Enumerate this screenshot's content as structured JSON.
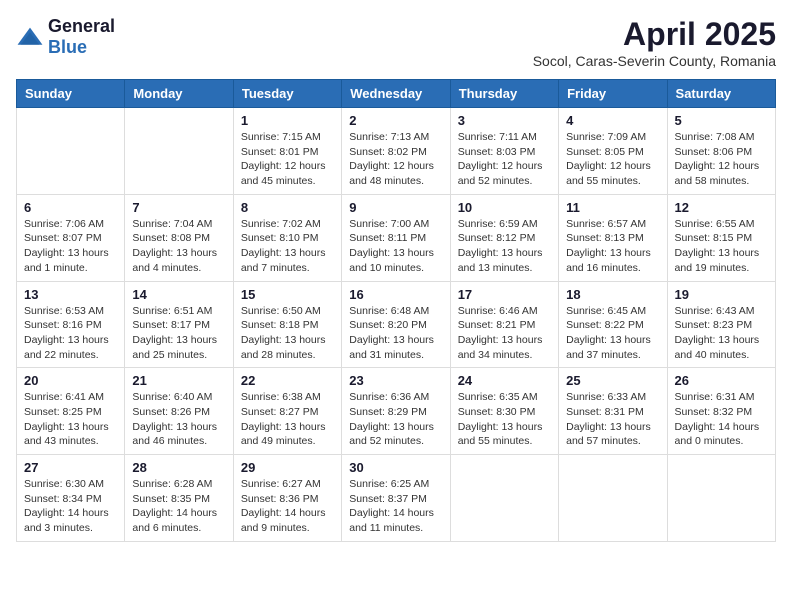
{
  "logo": {
    "general": "General",
    "blue": "Blue"
  },
  "title": "April 2025",
  "subtitle": "Socol, Caras-Severin County, Romania",
  "days_of_week": [
    "Sunday",
    "Monday",
    "Tuesday",
    "Wednesday",
    "Thursday",
    "Friday",
    "Saturday"
  ],
  "weeks": [
    [
      {
        "day": "",
        "info": ""
      },
      {
        "day": "",
        "info": ""
      },
      {
        "day": "1",
        "info": "Sunrise: 7:15 AM\nSunset: 8:01 PM\nDaylight: 12 hours and 45 minutes."
      },
      {
        "day": "2",
        "info": "Sunrise: 7:13 AM\nSunset: 8:02 PM\nDaylight: 12 hours and 48 minutes."
      },
      {
        "day": "3",
        "info": "Sunrise: 7:11 AM\nSunset: 8:03 PM\nDaylight: 12 hours and 52 minutes."
      },
      {
        "day": "4",
        "info": "Sunrise: 7:09 AM\nSunset: 8:05 PM\nDaylight: 12 hours and 55 minutes."
      },
      {
        "day": "5",
        "info": "Sunrise: 7:08 AM\nSunset: 8:06 PM\nDaylight: 12 hours and 58 minutes."
      }
    ],
    [
      {
        "day": "6",
        "info": "Sunrise: 7:06 AM\nSunset: 8:07 PM\nDaylight: 13 hours and 1 minute."
      },
      {
        "day": "7",
        "info": "Sunrise: 7:04 AM\nSunset: 8:08 PM\nDaylight: 13 hours and 4 minutes."
      },
      {
        "day": "8",
        "info": "Sunrise: 7:02 AM\nSunset: 8:10 PM\nDaylight: 13 hours and 7 minutes."
      },
      {
        "day": "9",
        "info": "Sunrise: 7:00 AM\nSunset: 8:11 PM\nDaylight: 13 hours and 10 minutes."
      },
      {
        "day": "10",
        "info": "Sunrise: 6:59 AM\nSunset: 8:12 PM\nDaylight: 13 hours and 13 minutes."
      },
      {
        "day": "11",
        "info": "Sunrise: 6:57 AM\nSunset: 8:13 PM\nDaylight: 13 hours and 16 minutes."
      },
      {
        "day": "12",
        "info": "Sunrise: 6:55 AM\nSunset: 8:15 PM\nDaylight: 13 hours and 19 minutes."
      }
    ],
    [
      {
        "day": "13",
        "info": "Sunrise: 6:53 AM\nSunset: 8:16 PM\nDaylight: 13 hours and 22 minutes."
      },
      {
        "day": "14",
        "info": "Sunrise: 6:51 AM\nSunset: 8:17 PM\nDaylight: 13 hours and 25 minutes."
      },
      {
        "day": "15",
        "info": "Sunrise: 6:50 AM\nSunset: 8:18 PM\nDaylight: 13 hours and 28 minutes."
      },
      {
        "day": "16",
        "info": "Sunrise: 6:48 AM\nSunset: 8:20 PM\nDaylight: 13 hours and 31 minutes."
      },
      {
        "day": "17",
        "info": "Sunrise: 6:46 AM\nSunset: 8:21 PM\nDaylight: 13 hours and 34 minutes."
      },
      {
        "day": "18",
        "info": "Sunrise: 6:45 AM\nSunset: 8:22 PM\nDaylight: 13 hours and 37 minutes."
      },
      {
        "day": "19",
        "info": "Sunrise: 6:43 AM\nSunset: 8:23 PM\nDaylight: 13 hours and 40 minutes."
      }
    ],
    [
      {
        "day": "20",
        "info": "Sunrise: 6:41 AM\nSunset: 8:25 PM\nDaylight: 13 hours and 43 minutes."
      },
      {
        "day": "21",
        "info": "Sunrise: 6:40 AM\nSunset: 8:26 PM\nDaylight: 13 hours and 46 minutes."
      },
      {
        "day": "22",
        "info": "Sunrise: 6:38 AM\nSunset: 8:27 PM\nDaylight: 13 hours and 49 minutes."
      },
      {
        "day": "23",
        "info": "Sunrise: 6:36 AM\nSunset: 8:29 PM\nDaylight: 13 hours and 52 minutes."
      },
      {
        "day": "24",
        "info": "Sunrise: 6:35 AM\nSunset: 8:30 PM\nDaylight: 13 hours and 55 minutes."
      },
      {
        "day": "25",
        "info": "Sunrise: 6:33 AM\nSunset: 8:31 PM\nDaylight: 13 hours and 57 minutes."
      },
      {
        "day": "26",
        "info": "Sunrise: 6:31 AM\nSunset: 8:32 PM\nDaylight: 14 hours and 0 minutes."
      }
    ],
    [
      {
        "day": "27",
        "info": "Sunrise: 6:30 AM\nSunset: 8:34 PM\nDaylight: 14 hours and 3 minutes."
      },
      {
        "day": "28",
        "info": "Sunrise: 6:28 AM\nSunset: 8:35 PM\nDaylight: 14 hours and 6 minutes."
      },
      {
        "day": "29",
        "info": "Sunrise: 6:27 AM\nSunset: 8:36 PM\nDaylight: 14 hours and 9 minutes."
      },
      {
        "day": "30",
        "info": "Sunrise: 6:25 AM\nSunset: 8:37 PM\nDaylight: 14 hours and 11 minutes."
      },
      {
        "day": "",
        "info": ""
      },
      {
        "day": "",
        "info": ""
      },
      {
        "day": "",
        "info": ""
      }
    ]
  ]
}
